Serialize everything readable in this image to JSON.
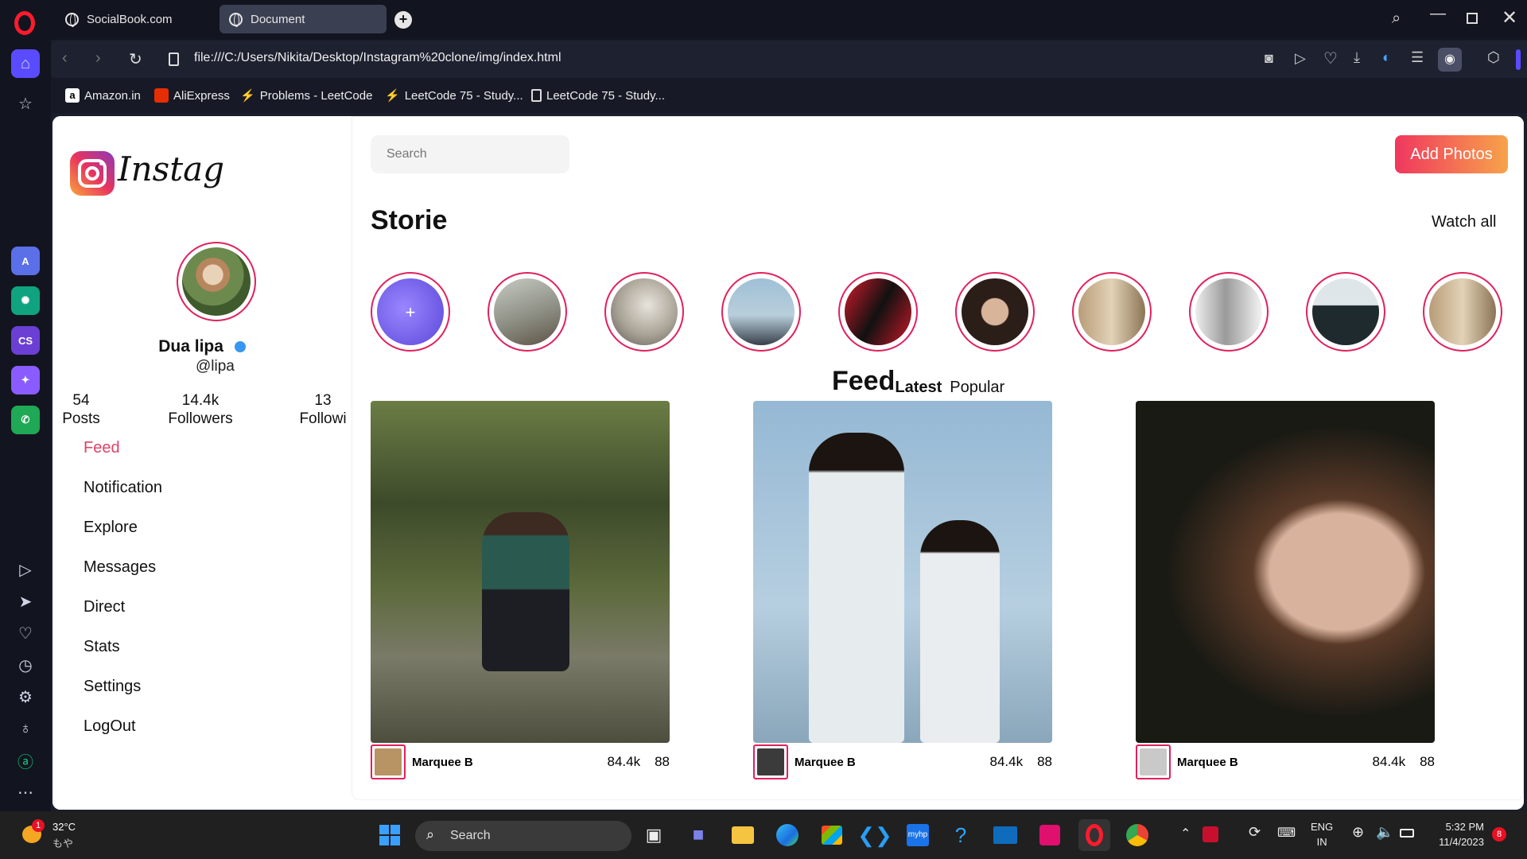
{
  "browser": {
    "tabs": [
      {
        "label": "SocialBook.com"
      },
      {
        "label": "Document"
      }
    ],
    "url": "file:///C:/Users/Nikita/Desktop/Instagram%20clone/img/index.html",
    "bookmarks": [
      {
        "label": "Amazon.in"
      },
      {
        "label": "AliExpress"
      },
      {
        "label": "Problems - LeetCode"
      },
      {
        "label": "LeetCode 75 - Study..."
      },
      {
        "label": "LeetCode 75 - Study..."
      }
    ]
  },
  "app": {
    "logo_text": "Instag",
    "search_placeholder": "Search",
    "add_photos_label": "Add Photos",
    "stories_title": "Storie",
    "watch_all_label": "Watch all",
    "feed_title": "Feed",
    "feed_tabs": [
      "Latest",
      "Popular"
    ]
  },
  "profile": {
    "name": "Dua lipa",
    "handle": "@lipa",
    "stats": [
      {
        "value": "54",
        "label": "Posts"
      },
      {
        "value": "14.4k",
        "label": "Followers"
      },
      {
        "value": "13",
        "label": "Followi"
      }
    ]
  },
  "nav": [
    {
      "label": "Feed",
      "active": true
    },
    {
      "label": "Notification"
    },
    {
      "label": "Explore"
    },
    {
      "label": "Messages"
    },
    {
      "label": "Direct"
    },
    {
      "label": "Stats"
    },
    {
      "label": "Settings"
    },
    {
      "label": "LogOut"
    }
  ],
  "posts": [
    {
      "author": "Marquee B",
      "likes": "84.4k",
      "comments": "88"
    },
    {
      "author": "Marquee B",
      "likes": "84.4k",
      "comments": "88"
    },
    {
      "author": "Marquee B",
      "likes": "84.4k",
      "comments": "88"
    }
  ],
  "taskbar": {
    "weather_temp": "32°C",
    "weather_sub": "もや",
    "weather_badge": "1",
    "search_label": "Search",
    "lang_top": "ENG",
    "lang_bottom": "IN",
    "time": "5:32 PM",
    "date": "11/4/2023",
    "notif_count": "8"
  },
  "colors": {
    "accent": "#e0215c",
    "feed_active": "#e0406a",
    "add_photos_from": "#f0375f",
    "add_photos_to": "#f7a34a"
  }
}
